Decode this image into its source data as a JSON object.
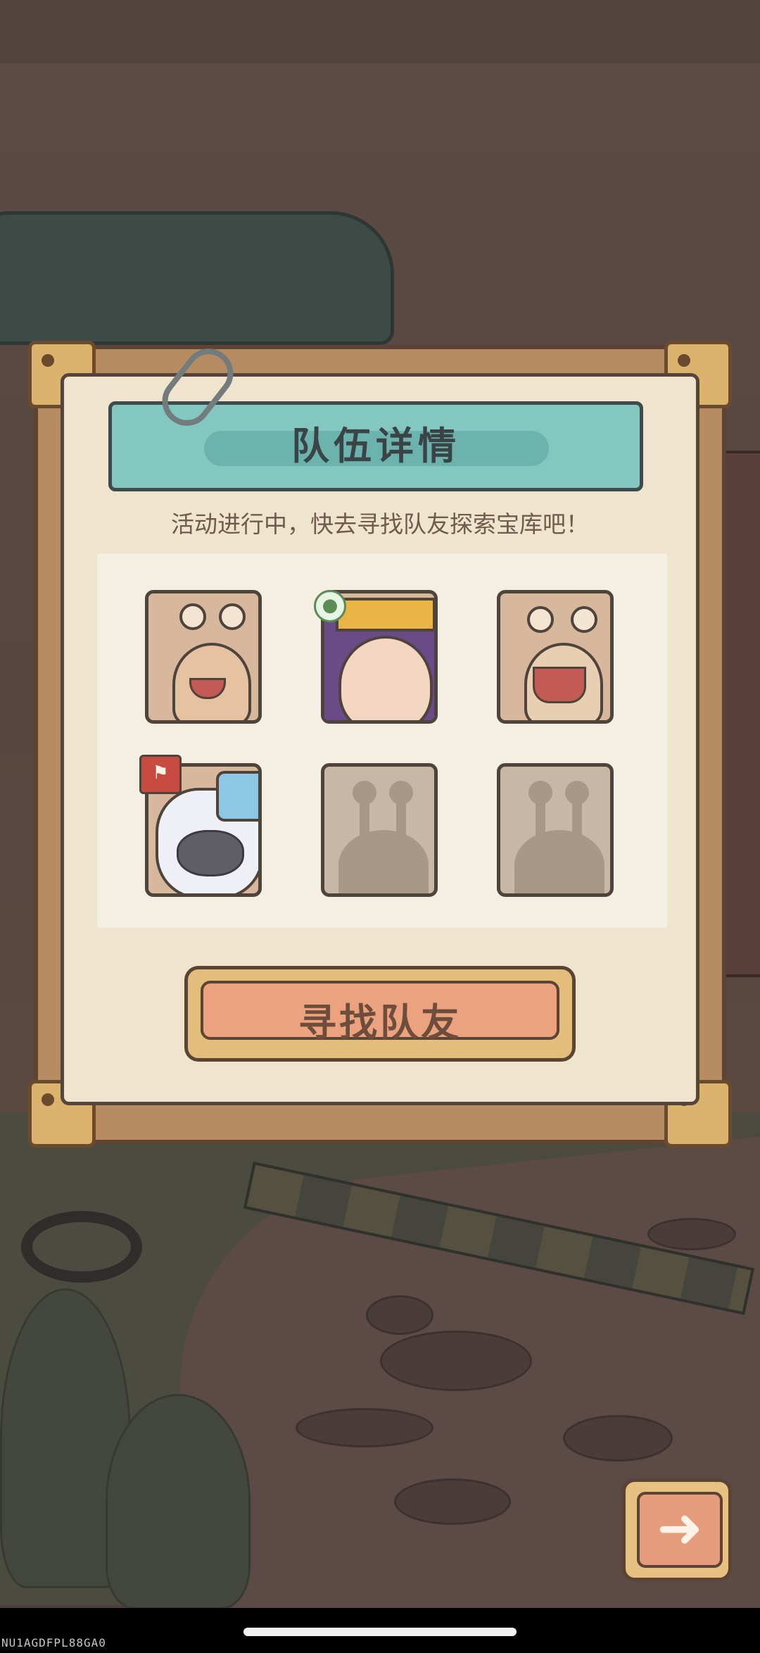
{
  "dialog": {
    "title": "队伍详情",
    "subtitle": "活动进行中，快去寻找队友探索宝库吧！"
  },
  "team_slots": [
    {
      "id": 1,
      "state": "filled",
      "character": "snail"
    },
    {
      "id": 2,
      "state": "filled",
      "character": "princess",
      "badge": "friend-icon"
    },
    {
      "id": 3,
      "state": "filled",
      "character": "snail-open-mouth"
    },
    {
      "id": 4,
      "state": "filled",
      "character": "yeti",
      "badge": "leader-flag-icon"
    },
    {
      "id": 5,
      "state": "empty"
    },
    {
      "id": 6,
      "state": "empty"
    }
  ],
  "buttons": {
    "find_teammate": "寻找队友",
    "next_icon": "right-arrow-icon"
  },
  "watermark": "NU1AGDFPL88GA0",
  "colors": {
    "title_banner": "#84c7c1",
    "button_fill": "#eca27f",
    "paper": "#efe4cd",
    "frame": "#b88c62"
  }
}
